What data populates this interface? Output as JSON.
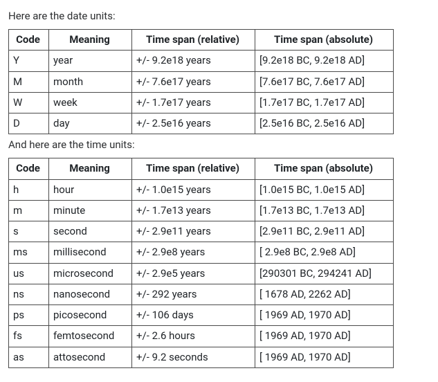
{
  "text": {
    "intro_date": "Here are the date units:",
    "intro_time": "And here are the time units:"
  },
  "headers": {
    "code": "Code",
    "meaning": "Meaning",
    "rel": "Time span (relative)",
    "abs": "Time span (absolute)"
  },
  "date_units": [
    {
      "code": "Y",
      "meaning": "year",
      "rel": "+/- 9.2e18 years",
      "abs": "[9.2e18 BC, 9.2e18 AD]"
    },
    {
      "code": "M",
      "meaning": "month",
      "rel": "+/- 7.6e17 years",
      "abs": "[7.6e17 BC, 7.6e17 AD]"
    },
    {
      "code": "W",
      "meaning": "week",
      "rel": "+/- 1.7e17 years",
      "abs": "[1.7e17 BC, 1.7e17 AD]"
    },
    {
      "code": "D",
      "meaning": "day",
      "rel": "+/- 2.5e16 years",
      "abs": "[2.5e16 BC, 2.5e16 AD]"
    }
  ],
  "time_units": [
    {
      "code": "h",
      "meaning": "hour",
      "rel": "+/- 1.0e15 years",
      "abs": "[1.0e15 BC, 1.0e15 AD]"
    },
    {
      "code": "m",
      "meaning": "minute",
      "rel": "+/- 1.7e13 years",
      "abs": "[1.7e13 BC, 1.7e13 AD]"
    },
    {
      "code": "s",
      "meaning": "second",
      "rel": "+/- 2.9e11 years",
      "abs": "[2.9e11 BC, 2.9e11 AD]"
    },
    {
      "code": "ms",
      "meaning": "millisecond",
      "rel": "+/- 2.9e8 years",
      "abs": "[ 2.9e8 BC, 2.9e8 AD]"
    },
    {
      "code": "us",
      "meaning": "microsecond",
      "rel": "+/- 2.9e5 years",
      "abs": "[290301 BC, 294241 AD]"
    },
    {
      "code": "ns",
      "meaning": "nanosecond",
      "rel": "+/- 292 years",
      "abs": "[ 1678 AD, 2262 AD]"
    },
    {
      "code": "ps",
      "meaning": "picosecond",
      "rel": "+/- 106 days",
      "abs": "[ 1969 AD, 1970 AD]"
    },
    {
      "code": "fs",
      "meaning": "femtosecond",
      "rel": "+/- 2.6 hours",
      "abs": "[ 1969 AD, 1970 AD]"
    },
    {
      "code": "as",
      "meaning": "attosecond",
      "rel": "+/- 9.2 seconds",
      "abs": "[ 1969 AD, 1970 AD]"
    }
  ],
  "chart_data": [
    {
      "type": "table",
      "title": "Date units",
      "columns": [
        "Code",
        "Meaning",
        "Time span (relative)",
        "Time span (absolute)"
      ],
      "rows": [
        [
          "Y",
          "year",
          "+/- 9.2e18 years",
          "[9.2e18 BC, 9.2e18 AD]"
        ],
        [
          "M",
          "month",
          "+/- 7.6e17 years",
          "[7.6e17 BC, 7.6e17 AD]"
        ],
        [
          "W",
          "week",
          "+/- 1.7e17 years",
          "[1.7e17 BC, 1.7e17 AD]"
        ],
        [
          "D",
          "day",
          "+/- 2.5e16 years",
          "[2.5e16 BC, 2.5e16 AD]"
        ]
      ]
    },
    {
      "type": "table",
      "title": "Time units",
      "columns": [
        "Code",
        "Meaning",
        "Time span (relative)",
        "Time span (absolute)"
      ],
      "rows": [
        [
          "h",
          "hour",
          "+/- 1.0e15 years",
          "[1.0e15 BC, 1.0e15 AD]"
        ],
        [
          "m",
          "minute",
          "+/- 1.7e13 years",
          "[1.7e13 BC, 1.7e13 AD]"
        ],
        [
          "s",
          "second",
          "+/- 2.9e11 years",
          "[2.9e11 BC, 2.9e11 AD]"
        ],
        [
          "ms",
          "millisecond",
          "+/- 2.9e8 years",
          "[ 2.9e8 BC, 2.9e8 AD]"
        ],
        [
          "us",
          "microsecond",
          "+/- 2.9e5 years",
          "[290301 BC, 294241 AD]"
        ],
        [
          "ns",
          "nanosecond",
          "+/- 292 years",
          "[ 1678 AD, 2262 AD]"
        ],
        [
          "ps",
          "picosecond",
          "+/- 106 days",
          "[ 1969 AD, 1970 AD]"
        ],
        [
          "fs",
          "femtosecond",
          "+/- 2.6 hours",
          "[ 1969 AD, 1970 AD]"
        ],
        [
          "as",
          "attosecond",
          "+/- 9.2 seconds",
          "[ 1969 AD, 1970 AD]"
        ]
      ]
    }
  ]
}
